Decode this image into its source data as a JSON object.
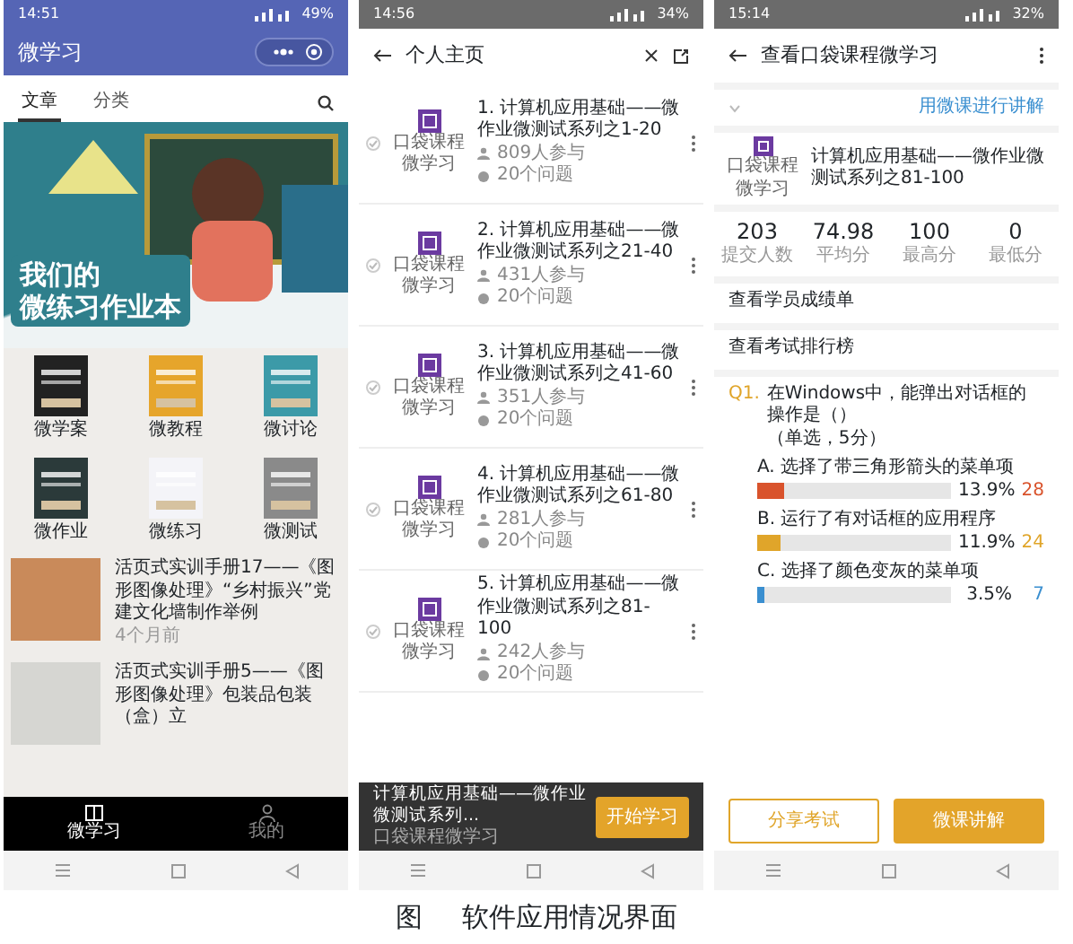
{
  "home_screen": {
    "status_bar": {
      "time": "14:51",
      "battery": "49%"
    },
    "app_title": "微学习",
    "tabs": [
      {
        "label": "文章",
        "selected": true
      },
      {
        "label": "分类",
        "selected": false
      }
    ],
    "banner": {
      "line_1": "我们的",
      "line_2": "微练习作业本"
    },
    "categories": [
      {
        "label": "微学案"
      },
      {
        "label": "微教程"
      },
      {
        "label": "微讨论"
      },
      {
        "label": "微作业"
      },
      {
        "label": "微练习"
      },
      {
        "label": "微测试"
      }
    ],
    "articles": [
      {
        "title": "活页式实训手册17——《图形图像处理》“乡村振兴”党建文化墙制作举例",
        "time": "4个月前"
      },
      {
        "title": "活页式实训手册5——《图形图像处理》包装品包装（盒）立"
      }
    ],
    "bottom_nav": [
      {
        "label": "微学习",
        "selected": true,
        "kind": "book"
      },
      {
        "label": "我的",
        "selected": false,
        "kind": "person"
      }
    ]
  },
  "profile_screen": {
    "status_bar": {
      "time": "14:56",
      "battery": "34%"
    },
    "title": "个人主页",
    "courses": [
      {
        "publisher": "口袋课程微学习",
        "title": "1. 计算机应用基础——微作业微测试系列之1-20",
        "participants": "809人参与",
        "questions": "20个问题"
      },
      {
        "publisher": "口袋课程微学习",
        "title": "2. 计算机应用基础——微作业微测试系列之21-40",
        "participants": "431人参与",
        "questions": "20个问题"
      },
      {
        "publisher": "口袋课程微学习",
        "title": "3. 计算机应用基础——微作业微测试系列之41-60",
        "participants": "351人参与",
        "questions": "20个问题"
      },
      {
        "publisher": "口袋课程微学习",
        "title": "4. 计算机应用基础——微作业微测试系列之61-80",
        "participants": "281人参与",
        "questions": "20个问题"
      },
      {
        "publisher": "口袋课程微学习",
        "title": "5. 计算机应用基础——微作业微测试系列之81-100",
        "participants": "242人参与",
        "questions": "20个问题"
      }
    ],
    "popup": {
      "title": "计算机应用基础——微作业微测试系列...",
      "publisher": "口袋课程微学习",
      "button": "开始学习"
    }
  },
  "detail_screen": {
    "status_bar": {
      "time": "15:14",
      "battery": "32%"
    },
    "title": "查看口袋课程微学习",
    "link": "用微课进行讲解",
    "course": {
      "publisher": "口袋课程微学习",
      "title": "计算机应用基础——微作业微测试系列之81-100"
    },
    "stats": [
      {
        "value": "203",
        "label": "提交人数"
      },
      {
        "value": "74.98",
        "label": "平均分"
      },
      {
        "value": "100",
        "label": "最高分"
      },
      {
        "value": "0",
        "label": "最低分"
      }
    ],
    "menu": [
      "查看学员成绩单",
      "查看考试排行榜"
    ],
    "question": {
      "number": "Q1.",
      "text": "在Windows中，能弹出对话框的操作是（）",
      "note": "（单选，5分）",
      "options": [
        {
          "label": "A. 选择了带三角形箭头的菜单项",
          "level": 0.139,
          "percent": "13.9%",
          "count": "28",
          "color": "#d9532c"
        },
        {
          "label": "B. 运行了有对话框的应用程序",
          "level": 0.119,
          "percent": "11.9%",
          "count": "24",
          "color": "#e0a52a"
        },
        {
          "label": "C. 选择了颜色变灰的菜单项",
          "level": 0.035,
          "percent": "3.5%",
          "count": "7",
          "color": "#3a8fd0"
        }
      ]
    },
    "buttons": [
      {
        "label": "分享考试",
        "kind": "outline"
      },
      {
        "label": "微课讲解",
        "kind": "filled"
      }
    ]
  },
  "caption": {
    "figure_label": "图",
    "text": "软件应用情况界面"
  }
}
